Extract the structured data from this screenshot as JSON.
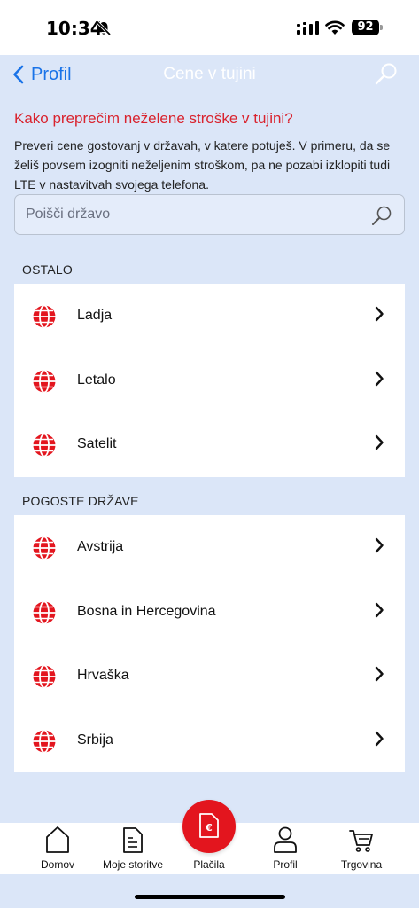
{
  "status_bar": {
    "time": "10:34",
    "battery": "92"
  },
  "nav": {
    "back_label": "Profil",
    "title": "Cene v tujini"
  },
  "intro": {
    "title": "Kako preprečim neželene stroške v tujini?",
    "text": "Preveri cene gostovanj v državah, v katere potuješ. V primeru, da se želiš povsem izogniti neželjenim stroškom, pa ne pozabi izklopiti tudi LTE v nastavitvah svojega telefona."
  },
  "search": {
    "placeholder": "Poišči državo"
  },
  "sections": [
    {
      "label": "OSTALO",
      "items": [
        {
          "label": "Ladja"
        },
        {
          "label": "Letalo"
        },
        {
          "label": "Satelit"
        }
      ]
    },
    {
      "label": "POGOSTE DRŽAVE",
      "items": [
        {
          "label": "Avstrija"
        },
        {
          "label": "Bosna in Hercegovina"
        },
        {
          "label": "Hrvaška"
        },
        {
          "label": "Srbija"
        }
      ]
    }
  ],
  "tabs": [
    {
      "label": "Domov",
      "icon": "home-icon"
    },
    {
      "label": "Moje storitve",
      "icon": "document-icon"
    },
    {
      "label": "Plačila",
      "icon": "payment-icon"
    },
    {
      "label": "Profil",
      "icon": "user-icon"
    },
    {
      "label": "Trgovina",
      "icon": "cart-icon"
    }
  ],
  "colors": {
    "accent_red": "#e3151e",
    "link_blue": "#1a73e8",
    "background": "#dbe6f8"
  }
}
